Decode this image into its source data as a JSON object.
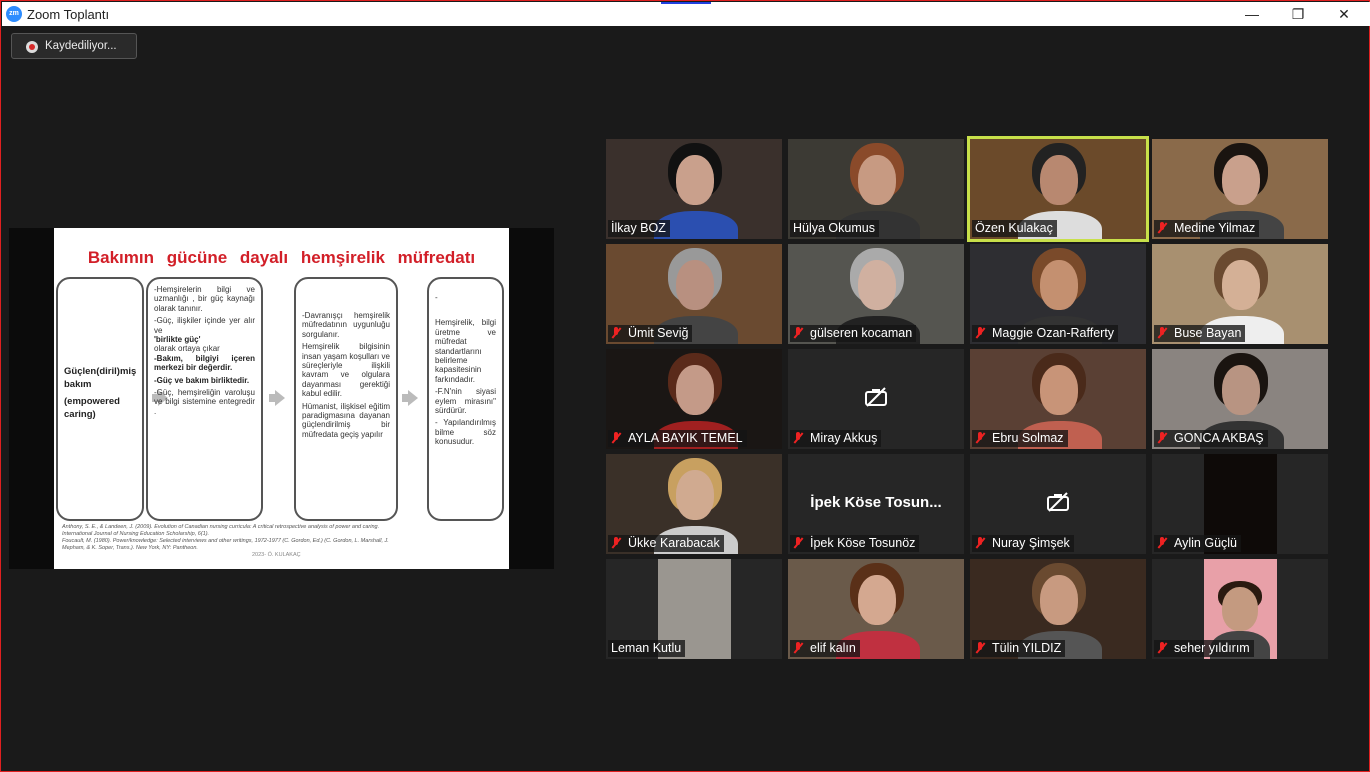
{
  "window": {
    "title": "Zoom Toplantı",
    "app_icon_text": "zm",
    "buttons": {
      "minimize": "—",
      "maximize": "❐",
      "close": "✕"
    }
  },
  "recording": {
    "label": "Kaydediliyor..."
  },
  "slide": {
    "title": "Bakımın gücüne dayalı hemşirelik müfredatı",
    "box1": {
      "line1": "Güçlen(diril)miş bakım",
      "line2": "(empowered caring)"
    },
    "box2": [
      "-Hemşirelerin bilgi ve uzmanlığı , bir güç kaynağı olarak tanınır.",
      "-Güç, ilişkiler içinde yer alır ve",
      "'birlikte güç'",
      "olarak ortaya çıkar",
      "-Bakım, bilgiyi içeren merkezi bir değerdir.",
      "-Güç ve bakım birliktedir.",
      "-Güç, hemşireliğin varoluşu ve bilgi sistemine entegredir ."
    ],
    "box3": [
      "-Davranışçı hemşirelik müfredatının uygunluğu sorgulanır.",
      "Hemşirelik bilgisinin insan yaşam koşulları ve süreçleriyle ilişkili kavram ve olgulara dayanması gerektiği kabul edilir.",
      "Hümanist, ilişkisel eğitim paradigmasına dayanan güçlendirilmiş bir müfredata geçiş yapılır"
    ],
    "box4": [
      "-",
      "Hemşirelik, bilgi üretme ve müfredat standartlarını belirleme kapasitesinin farkındadır.",
      "-F.N'nin siyasi eylem mirasını\" sürdürür.",
      "- Yapılandırılmış bilme söz konusudur."
    ],
    "references": [
      "Anthony, S. E., & Landeen, J. (2009). Evolution of Canadian nursing curricula: A critical retrospective analysis of power and caring.",
      "International Journal of Nursing Education Scholarship, 6(1).",
      "Foucault, M. (1980). Power/knowledge: Selected interviews and other writings, 1972-1977 (C. Gordon, Ed.) (C. Gordon, L. Marshall, J.",
      "Mepham, & K. Soper, Trans.). New York, NY: Pantheon."
    ],
    "signature": "2023- Ö. KULAKAÇ"
  },
  "participants": [
    {
      "name": "İlkay BOZ",
      "muted": false,
      "bg": "#3a302c",
      "skin": "#c9a08c",
      "shirt": "#2b4fb0",
      "hair": "#111"
    },
    {
      "name": "Hülya Okumus",
      "muted": false,
      "bg": "#3c3a34",
      "skin": "#c79a82",
      "shirt": "#333",
      "hair": "#8a4a2a"
    },
    {
      "name": "Özen Kulakaç",
      "muted": false,
      "bg": "#6b4a2a",
      "skin": "#b88870",
      "shirt": "#ddd",
      "hair": "#222",
      "active": true
    },
    {
      "name": "Medine Yilmaz",
      "muted": true,
      "bg": "#8a6a4a",
      "skin": "#c9a08c",
      "shirt": "#444",
      "hair": "#1a1410"
    },
    {
      "name": "Ümit Seviğ",
      "muted": true,
      "bg": "#6a4a30",
      "skin": "#b89080",
      "shirt": "#444",
      "hair": "#999"
    },
    {
      "name": "gülseren kocaman",
      "muted": true,
      "bg": "#555550",
      "skin": "#d0b0a0",
      "shirt": "#222",
      "hair": "#aaa"
    },
    {
      "name": "Maggie Ozan-Rafferty",
      "muted": true,
      "bg": "#2e2e32",
      "skin": "#c49070",
      "shirt": "#333",
      "hair": "#7a4a2a"
    },
    {
      "name": "Buse Bayan",
      "muted": true,
      "bg": "#a89070",
      "skin": "#d4b096",
      "shirt": "#eee",
      "hair": "#6a4a30"
    },
    {
      "name": "AYLA BAYIK TEMEL",
      "muted": true,
      "bg": "#1a1614",
      "skin": "#c49a88",
      "shirt": "#a02020",
      "hair": "#5a2a1a"
    },
    {
      "name": "Miray Akkuş",
      "muted": true,
      "camera_off": true
    },
    {
      "name": "Ebru Solmaz",
      "muted": true,
      "bg": "#5a4034",
      "skin": "#c89478",
      "shirt": "#c06050",
      "hair": "#4a2a1a"
    },
    {
      "name": "GONCA AKBAŞ",
      "muted": true,
      "bg": "#8a8480",
      "skin": "#b89482",
      "shirt": "#333",
      "hair": "#1a1410"
    },
    {
      "name": "Ükke Karabacak",
      "muted": true,
      "bg": "#3a3028",
      "skin": "#d0aa90",
      "shirt": "#ccc",
      "hair": "#c8a060"
    },
    {
      "name": "İpek Köse Tosunöz",
      "muted": true,
      "display_name": "İpek Köse Tosun..."
    },
    {
      "name": "Nuray Şimşek",
      "muted": true,
      "camera_off": true
    },
    {
      "name": "Aylin Güçlü",
      "muted": true,
      "bg": "#0e0a08",
      "narrow": true
    },
    {
      "name": "Leman Kutlu",
      "muted": false,
      "bg": "#9a9690",
      "narrow": true
    },
    {
      "name": "elif kalın",
      "muted": true,
      "bg": "#6a5a4a",
      "skin": "#d4a890",
      "shirt": "#c03040",
      "hair": "#5a3018"
    },
    {
      "name": "Tülin YILDIZ",
      "muted": true,
      "bg": "#3a2a20",
      "skin": "#c89a80",
      "shirt": "#555",
      "hair": "#6a4a30"
    },
    {
      "name": "seher yıldırım",
      "muted": true,
      "bg": "#e8a0a8",
      "skin": "#c49a80",
      "shirt": "#444",
      "hair": "#2a1a10",
      "narrow": true
    }
  ]
}
